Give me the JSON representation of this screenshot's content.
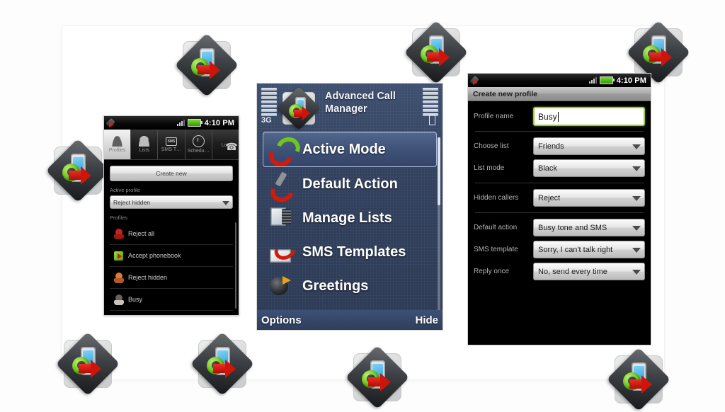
{
  "app": {
    "name": "Advanced Call Manager",
    "icon": "app-logo-icon"
  },
  "left_phone": {
    "status_bar": {
      "time": "4:10 PM",
      "signal_icon": "signal-bars-icon",
      "battery_icon": "battery-icon",
      "app_icon": "app-logo-icon"
    },
    "tabs": [
      {
        "label": "Profiles",
        "icon": "person-icon",
        "selected": true
      },
      {
        "label": "Lists",
        "icon": "people-icon",
        "selected": false
      },
      {
        "label": "SMS T…",
        "icon": "sms-icon",
        "selected": false
      },
      {
        "label": "Schedu…",
        "icon": "clock-icon",
        "selected": false
      },
      {
        "label": "Log",
        "icon": "phone-handset-icon",
        "selected": false
      }
    ],
    "create_button": "Create new",
    "active_profile_label": "Active profile",
    "active_profile_value": "Reject hidden",
    "profiles_label": "Profiles",
    "profiles": [
      {
        "name": "Reject all",
        "icon": "reject-all-icon"
      },
      {
        "name": "Accept phonebook",
        "icon": "phonebook-icon"
      },
      {
        "name": "Reject hidden",
        "icon": "reject-hidden-icon"
      },
      {
        "name": "Busy",
        "icon": "busy-icon"
      }
    ]
  },
  "middle_phone": {
    "network": "3G",
    "title": "Advanced Call Manager",
    "menu": [
      {
        "label": "Active Mode",
        "icon": "swirl-arrows-icon",
        "selected": true
      },
      {
        "label": "Default Action",
        "icon": "wrench-arrow-icon",
        "selected": false
      },
      {
        "label": "Manage Lists",
        "icon": "lists-icon",
        "selected": false
      },
      {
        "label": "SMS Templates",
        "icon": "sms-envelope-icon",
        "selected": false
      },
      {
        "label": "Greetings",
        "icon": "megaphone-icon",
        "selected": false
      }
    ],
    "softkey_left": "Options",
    "softkey_right": "Hide"
  },
  "right_phone": {
    "status_bar": {
      "time": "4:10 PM",
      "signal_icon": "signal-bars-icon",
      "battery_icon": "battery-icon",
      "app_icon": "app-logo-icon"
    },
    "title": "Create new profile",
    "fields": [
      {
        "label": "Profile name",
        "value": "Busy",
        "type": "text"
      },
      {
        "label": "Choose list",
        "value": "Friends",
        "type": "select"
      },
      {
        "label": "List mode",
        "value": "Black",
        "type": "select"
      },
      {
        "label": "Hidden callers",
        "value": "Reject",
        "type": "select"
      },
      {
        "label": "Default action",
        "value": "Busy tone and SMS",
        "type": "select"
      },
      {
        "label": "SMS template",
        "value": "Sorry, I can't talk right",
        "type": "select"
      },
      {
        "label": "Reply once",
        "value": "No, send every time",
        "type": "select"
      }
    ]
  },
  "colors": {
    "page_background": "#fdfdfd",
    "card_background": "#ffffff",
    "symbian_blue": "#32415e",
    "focus_green": "#9fc933",
    "accent_red": "#cf1409",
    "accent_green": "#66c21b"
  }
}
